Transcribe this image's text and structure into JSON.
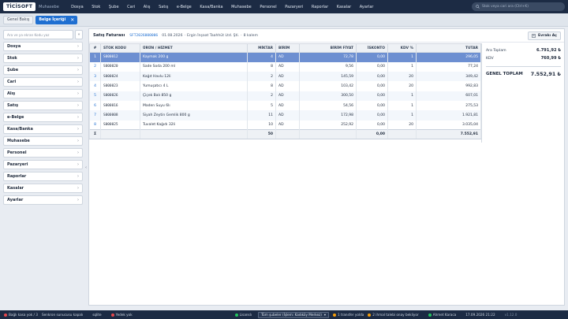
{
  "app": {
    "logo": "TİCİSOFT",
    "subtitle": "Muhasebe"
  },
  "menu": [
    "Dosya",
    "Stok",
    "Şube",
    "Cari",
    "Alış",
    "Satış",
    "e-Belge",
    "Kasa/Banka",
    "Muhasebe",
    "Personel",
    "Pazaryeri",
    "Raporlar",
    "Kasalar",
    "Ayarlar"
  ],
  "search": {
    "placeholder": "Stok veya cari ara (Ctrl+K)"
  },
  "tabs": [
    {
      "label": "Genel Bakış"
    },
    {
      "label": "Belge İçeriği",
      "close": "✕"
    }
  ],
  "sidebar": {
    "search_placeholder": "Ara ve ya ekran Kodu yaz",
    "collapse_btn": "«",
    "items": [
      "Dosya",
      "Stok",
      "Şube",
      "Cari",
      "Alış",
      "Satış",
      "e-Belge",
      "Kasa/Banka",
      "Muhasebe",
      "Personel",
      "Pazaryeri",
      "Raporlar",
      "Kasalar",
      "Ayarlar"
    ]
  },
  "document": {
    "label": "Satış Faturası",
    "number": "SFT2026000006",
    "date": "01.08.2026",
    "customer": "Ergin İnşaat Taahhüt Ltd. Şti.",
    "item_count": "8 kalem",
    "attach_label": "Evrakı Aç"
  },
  "table": {
    "headers": [
      "#",
      "STOK KODU",
      "ÜRÜN / HİZMET",
      "MİKTAR",
      "BİRİM",
      "BİRİM FİYAT",
      "İSKONTO",
      "KDV %",
      "TUTAR"
    ],
    "rows": [
      [
        "1",
        "S000012",
        "Kaymak 200 g",
        "4",
        "AD",
        "72,78",
        "0,00",
        "1",
        "296,05"
      ],
      [
        "2",
        "S000020",
        "Sade Soda 200 ml",
        "8",
        "AD",
        "9,56",
        "0,00",
        "1",
        "77,24"
      ],
      [
        "3",
        "S000024",
        "Kağıt Havlu 12li",
        "2",
        "AD",
        "145,59",
        "0,00",
        "20",
        "349,42"
      ],
      [
        "4",
        "S000023",
        "Yumuşatıcı 4 L",
        "8",
        "AD",
        "103,42",
        "0,00",
        "20",
        "992,83"
      ],
      [
        "5",
        "S000026",
        "Çiçek Balı 850 g",
        "2",
        "AD",
        "300,50",
        "0,00",
        "1",
        "607,01"
      ],
      [
        "6",
        "S000016",
        "Maden Suyu 6lı",
        "5",
        "AD",
        "54,56",
        "0,00",
        "1",
        "275,53"
      ],
      [
        "7",
        "S000008",
        "Siyah Zeytin Gemlik 800 g",
        "11",
        "AD",
        "172,98",
        "0,00",
        "1",
        "1.921,81"
      ],
      [
        "8",
        "S000025",
        "Tuvalet Kağıdı 32li",
        "10",
        "AD",
        "252,92",
        "0,00",
        "20",
        "3.035,04"
      ]
    ],
    "totals": {
      "sigma": "Σ",
      "qty": "50",
      "discount": "0,00",
      "total": "7.552,91"
    }
  },
  "summary": {
    "subtotal_label": "Ara Toplam",
    "subtotal": "6.791,92 ₺",
    "vat_label": "KDV",
    "vat": "760,99 ₺",
    "total_label": "GENEL TOPLAM",
    "total": "7.552,91 ₺"
  },
  "status": {
    "cash_register": "Bağlı kasa yok / 3",
    "server": "Senkron sunucusu kapalı",
    "conn": "sqlite",
    "backup": "Yedek yok",
    "license": "Lisanslı",
    "branch": "Tüm şubeler (İşlem: Kadıköy Merkez)",
    "transfer": "1 transfer yolda",
    "approvals": "2 ihmal talebi onay bekliyor",
    "user": "Ahmet Karaca",
    "datetime": "17.09.2026 21:22",
    "version": "v1.12.0"
  },
  "colors": {
    "topbar": "#1c2b44",
    "accent": "#1f6fd1",
    "selected_row": "#6d8fd1"
  }
}
